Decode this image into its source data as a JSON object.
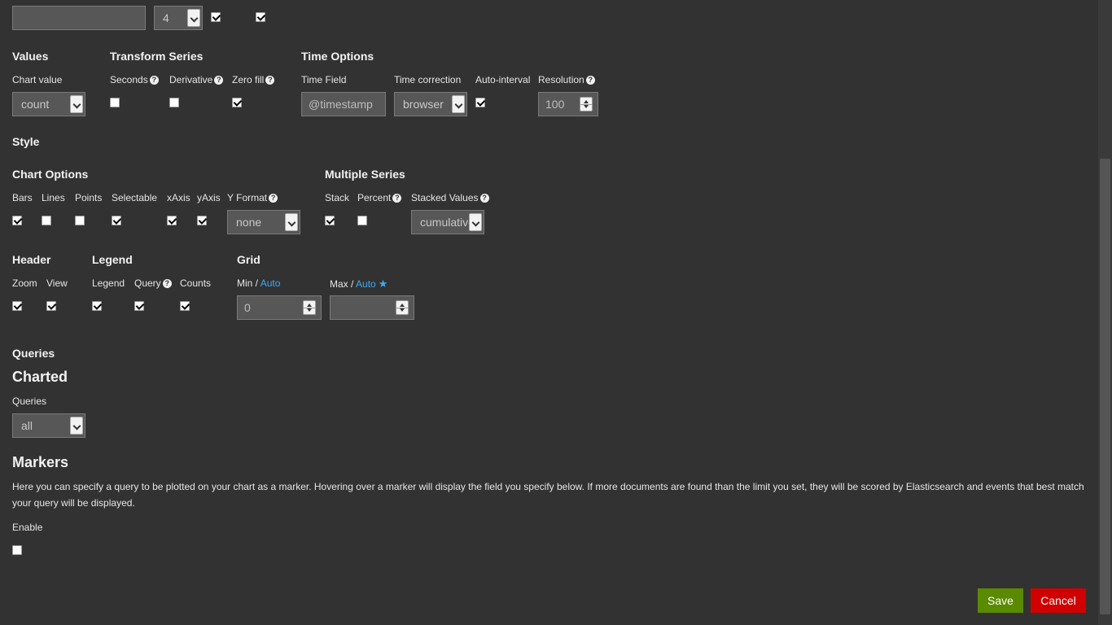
{
  "top": {
    "select_value": "4"
  },
  "values": {
    "title": "Values",
    "chart_value_label": "Chart value",
    "chart_value": "count"
  },
  "transform": {
    "title": "Transform Series",
    "seconds": "Seconds",
    "derivative": "Derivative",
    "zero_fill": "Zero fill"
  },
  "time": {
    "title": "Time Options",
    "field_label": "Time Field",
    "field_value": "@timestamp",
    "correction_label": "Time correction",
    "correction_value": "browser",
    "auto_interval_label": "Auto-interval",
    "resolution_label": "Resolution",
    "resolution_value": "100"
  },
  "style": {
    "title": "Style"
  },
  "chart_options": {
    "title": "Chart Options",
    "bars": "Bars",
    "lines": "Lines",
    "points": "Points",
    "selectable": "Selectable",
    "xaxis": "xAxis",
    "yaxis": "yAxis",
    "y_format_label": "Y Format",
    "y_format_value": "none"
  },
  "multiple": {
    "title": "Multiple Series",
    "stack": "Stack",
    "percent": "Percent",
    "stacked_values_label": "Stacked Values",
    "stacked_values_value": "cumulative"
  },
  "header": {
    "title": "Header",
    "zoom": "Zoom",
    "view": "View"
  },
  "legend": {
    "title": "Legend",
    "legend": "Legend",
    "query": "Query",
    "counts": "Counts"
  },
  "grid": {
    "title": "Grid",
    "min_label": "Min /",
    "max_label": "Max /",
    "auto": "Auto",
    "min_value": "0",
    "max_value": ""
  },
  "queries": {
    "title": "Queries",
    "charted": "Charted",
    "queries_label": "Queries",
    "queries_value": "all"
  },
  "markers": {
    "title": "Markers",
    "description": "Here you can specify a query to be plotted on your chart as a marker. Hovering over a marker will display the field you specify below. If more documents are found than the limit you set, they will be scored by Elasticsearch and events that best match your query will be displayed.",
    "enable_label": "Enable"
  },
  "buttons": {
    "save": "Save",
    "cancel": "Cancel"
  },
  "colors": {
    "save": "#5a8a00",
    "cancel": "#d10000",
    "link": "#3fa9f5",
    "background": "#323232"
  }
}
